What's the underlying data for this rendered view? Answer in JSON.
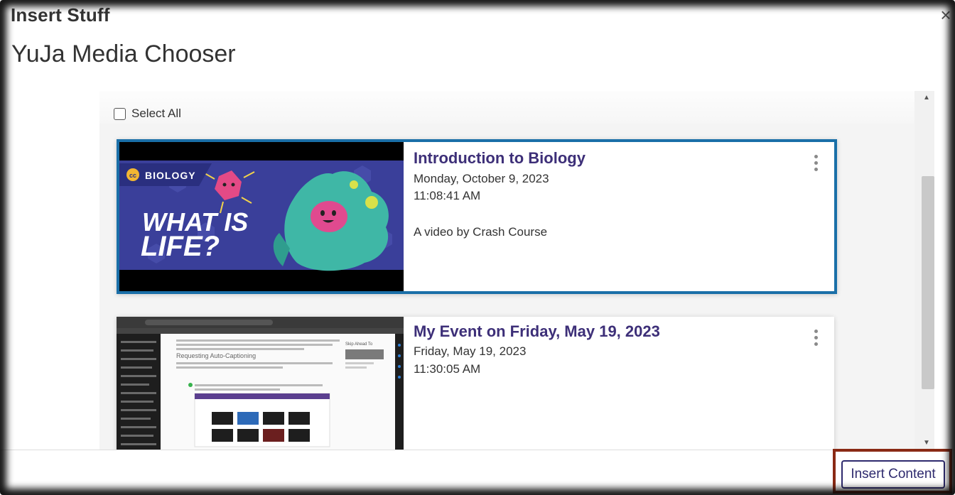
{
  "dialog": {
    "title": "Insert Stuff",
    "close_label": "×"
  },
  "chooser": {
    "title": "YuJa Media Chooser"
  },
  "select_all": {
    "label": "Select All",
    "checked": false
  },
  "media_items": [
    {
      "title": "Introduction to Biology",
      "date": "Monday, October 9, 2023",
      "time": "11:08:41 AM",
      "description": "A video by Crash Course",
      "selected": true,
      "thumbnail": {
        "badge": "BIOLOGY",
        "headline_line1": "WHAT IS",
        "headline_line2": "LIFE?"
      }
    },
    {
      "title": "My Event on Friday, May 19, 2023",
      "date": "Friday, May 19, 2023",
      "time": "11:30:05 AM",
      "description": "",
      "selected": false,
      "thumbnail": {
        "section_heading": "Requesting Auto-Captioning",
        "sidebar_heading": "Skip Ahead To"
      }
    }
  ],
  "footer": {
    "insert_label": "Insert Content"
  },
  "colors": {
    "selected_border": "#1a6fa8",
    "title_purple": "#3d2f78",
    "insert_highlight": "#8a2a15",
    "button_text": "#2e2a6e"
  }
}
